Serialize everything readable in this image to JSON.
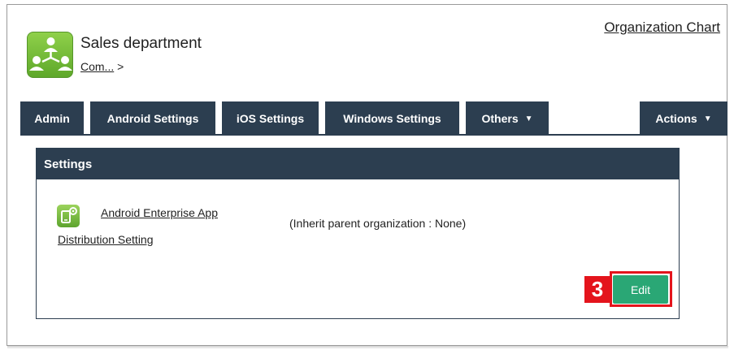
{
  "header": {
    "org_name": "Sales department",
    "breadcrumb_link": "Com...",
    "breadcrumb_separator": ">",
    "org_chart_link": "Organization Chart"
  },
  "tabs": [
    {
      "label": "Admin"
    },
    {
      "label": "Android Settings"
    },
    {
      "label": "iOS Settings"
    },
    {
      "label": "Windows Settings"
    },
    {
      "label": "Others",
      "caret": "▼"
    },
    {
      "label": "Actions",
      "caret": "▼"
    }
  ],
  "panel": {
    "title": "Settings",
    "setting_name_line1": "Android Enterprise App",
    "setting_name_line2": "Distribution Setting",
    "inherit_text": "(Inherit parent organization : None)",
    "edit_label": "Edit"
  },
  "annotation": {
    "step_number": "3",
    "color": "#e4141c"
  },
  "colors": {
    "navy": "#2c3e50",
    "edit_green": "#2aa775",
    "icon_green": "#6cb33f"
  },
  "icons": {
    "org": "org-tree-icon",
    "setting": "app-distribution-icon"
  }
}
